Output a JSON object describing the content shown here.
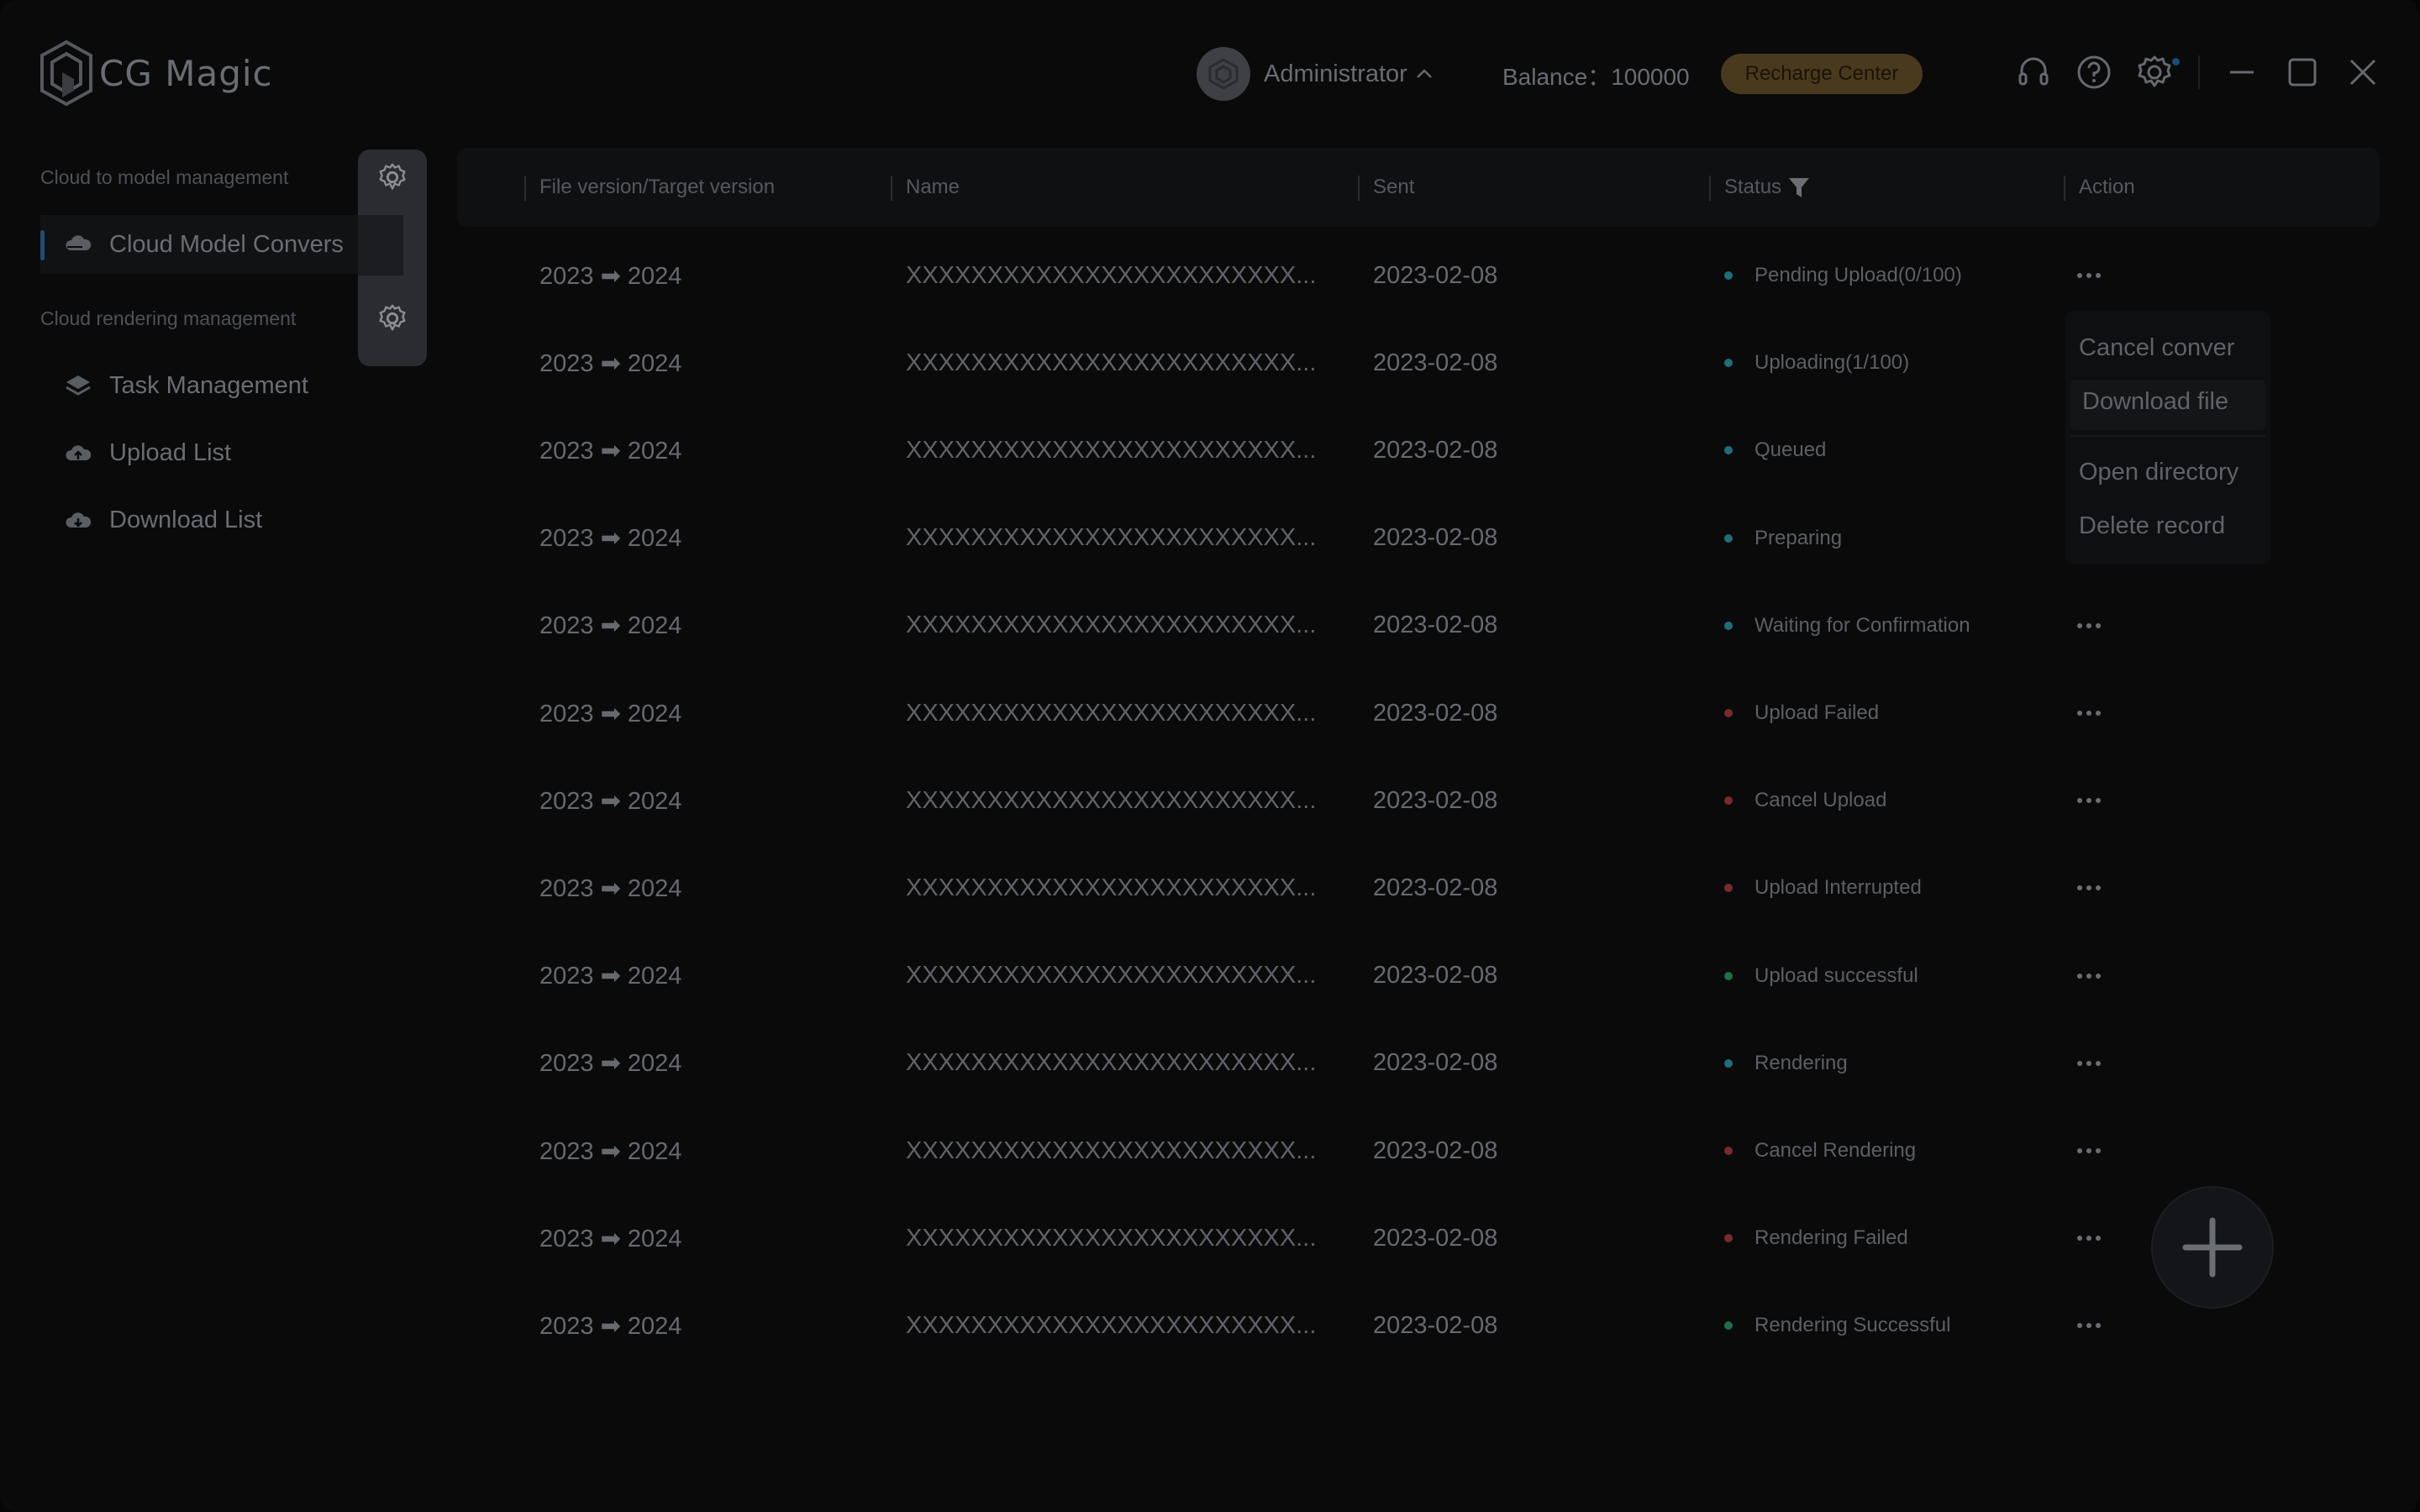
{
  "app": {
    "title": "CG Magic",
    "user_name": "Administrator",
    "balance_label": "Balance：",
    "balance_value": "100000",
    "recharge_label": "Recharge Center"
  },
  "sidebar": {
    "section1": "Cloud to model management",
    "item_cloud": "Cloud Model Convers",
    "section2": "Cloud rendering management",
    "item_task": "Task Management",
    "item_upload": "Upload List",
    "item_download": "Download List"
  },
  "table": {
    "headers": {
      "version": "File version/Target version",
      "name": "Name",
      "sent": "Sent",
      "status": "Status",
      "action": "Action"
    },
    "rows": [
      {
        "version": "2023 ➡ 2024",
        "name": "XXXXXXXXXXXXXXXXXXXXXXXX...",
        "sent": "2023-02-08",
        "status": "Pending Upload(0/100)",
        "status_color": "#1e6e7a",
        "show_action": true
      },
      {
        "version": "2023 ➡ 2024",
        "name": "XXXXXXXXXXXXXXXXXXXXXXXX...",
        "sent": "2023-02-08",
        "status": "Uploading(1/100)",
        "status_color": "#1e6e7a",
        "show_action": false
      },
      {
        "version": "2023 ➡ 2024",
        "name": "XXXXXXXXXXXXXXXXXXXXXXXX...",
        "sent": "2023-02-08",
        "status": "Queued",
        "status_color": "#1e6e7a",
        "show_action": false
      },
      {
        "version": "2023 ➡ 2024",
        "name": "XXXXXXXXXXXXXXXXXXXXXXXX...",
        "sent": "2023-02-08",
        "status": "Preparing",
        "status_color": "#1e6e7a",
        "show_action": false
      },
      {
        "version": "2023 ➡ 2024",
        "name": "XXXXXXXXXXXXXXXXXXXXXXXX...",
        "sent": "2023-02-08",
        "status": "Waiting for Confirmation",
        "status_color": "#1e6e7a",
        "show_action": true
      },
      {
        "version": "2023 ➡ 2024",
        "name": "XXXXXXXXXXXXXXXXXXXXXXXX...",
        "sent": "2023-02-08",
        "status": "Upload Failed",
        "status_color": "#7a2a2e",
        "show_action": true
      },
      {
        "version": "2023 ➡ 2024",
        "name": "XXXXXXXXXXXXXXXXXXXXXXXX...",
        "sent": "2023-02-08",
        "status": "Cancel Upload",
        "status_color": "#7a2a2e",
        "show_action": true
      },
      {
        "version": "2023 ➡ 2024",
        "name": "XXXXXXXXXXXXXXXXXXXXXXXX...",
        "sent": "2023-02-08",
        "status": "Upload Interrupted",
        "status_color": "#7a2a2e",
        "show_action": true
      },
      {
        "version": "2023 ➡ 2024",
        "name": "XXXXXXXXXXXXXXXXXXXXXXXX...",
        "sent": "2023-02-08",
        "status": "Upload successful",
        "status_color": "#1e6e4a",
        "show_action": true
      },
      {
        "version": "2023 ➡ 2024",
        "name": "XXXXXXXXXXXXXXXXXXXXXXXX...",
        "sent": "2023-02-08",
        "status": "Rendering",
        "status_color": "#1e6e7a",
        "show_action": true
      },
      {
        "version": "2023 ➡ 2024",
        "name": "XXXXXXXXXXXXXXXXXXXXXXXX...",
        "sent": "2023-02-08",
        "status": "Cancel Rendering",
        "status_color": "#7a2a2e",
        "show_action": true
      },
      {
        "version": "2023 ➡ 2024",
        "name": "XXXXXXXXXXXXXXXXXXXXXXXX...",
        "sent": "2023-02-08",
        "status": "Rendering Failed",
        "status_color": "#7a2a2e",
        "show_action": true
      },
      {
        "version": "2023 ➡ 2024",
        "name": "XXXXXXXXXXXXXXXXXXXXXXXX...",
        "sent": "2023-02-08",
        "status": "Rendering Successful",
        "status_color": "#1e6e4a",
        "show_action": true
      }
    ]
  },
  "menu": {
    "cancel": "Cancel conver",
    "download": "Download file",
    "open_dir": "Open directory",
    "delete": "Delete record"
  },
  "icons": {
    "logo": "cg-magic-logo-icon",
    "headset": "headset-icon",
    "help": "help-icon",
    "settings": "settings-icon",
    "minimize": "minimize-icon",
    "maximize": "maximize-icon",
    "close": "close-icon",
    "add": "plus-icon"
  }
}
